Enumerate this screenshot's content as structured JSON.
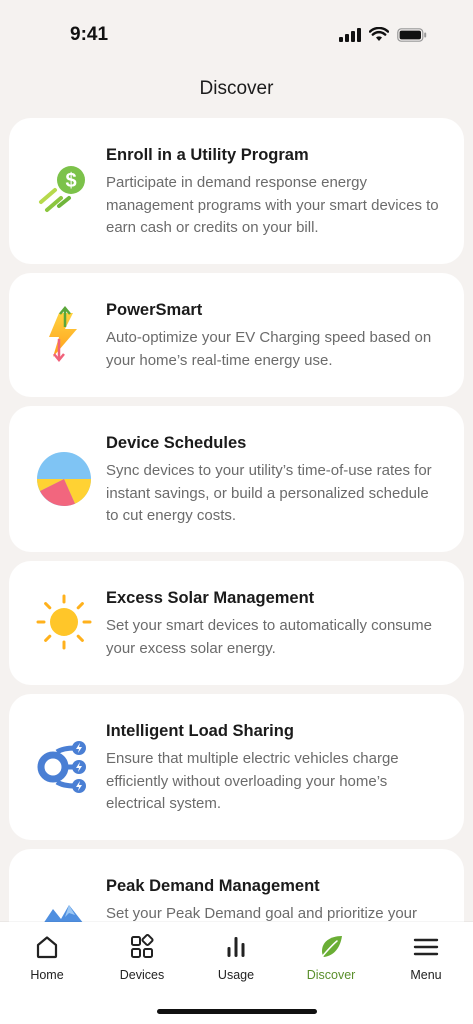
{
  "status_bar": {
    "time": "9:41"
  },
  "page": {
    "title": "Discover"
  },
  "cards": [
    {
      "title": "Enroll in a Utility Program",
      "description": "Participate in demand response energy management programs with your smart devices to earn cash or credits on your bill.",
      "icon": "dollar-coin-icon"
    },
    {
      "title": "PowerSmart",
      "description": "Auto-optimize your EV Charging speed based on your home’s real-time energy use.",
      "icon": "lightning-bolt-icon"
    },
    {
      "title": "Device Schedules",
      "description": "Sync devices to your utility’s time-of-use rates for instant savings, or build a personalized schedule to cut energy costs.",
      "icon": "pie-chart-icon"
    },
    {
      "title": "Excess Solar Management",
      "description": "Set your smart devices to automatically consume your excess solar energy.",
      "icon": "sun-icon"
    },
    {
      "title": "Intelligent Load Sharing",
      "description": "Ensure that multiple electric vehicles charge efficiently without overloading your home’s electrical system.",
      "icon": "load-sharing-icon"
    },
    {
      "title": "Peak Demand Management",
      "description": "Set your Peak Demand goal and prioritize your",
      "icon": "mountain-peak-icon"
    }
  ],
  "tab_bar": {
    "active": "Discover",
    "active_color": "#5a8f2c",
    "tabs": [
      {
        "label": "Home",
        "icon": "house-icon"
      },
      {
        "label": "Devices",
        "icon": "devices-grid-icon"
      },
      {
        "label": "Usage",
        "icon": "bar-chart-icon"
      },
      {
        "label": "Discover",
        "icon": "leaf-icon"
      },
      {
        "label": "Menu",
        "icon": "hamburger-menu-icon"
      }
    ]
  }
}
